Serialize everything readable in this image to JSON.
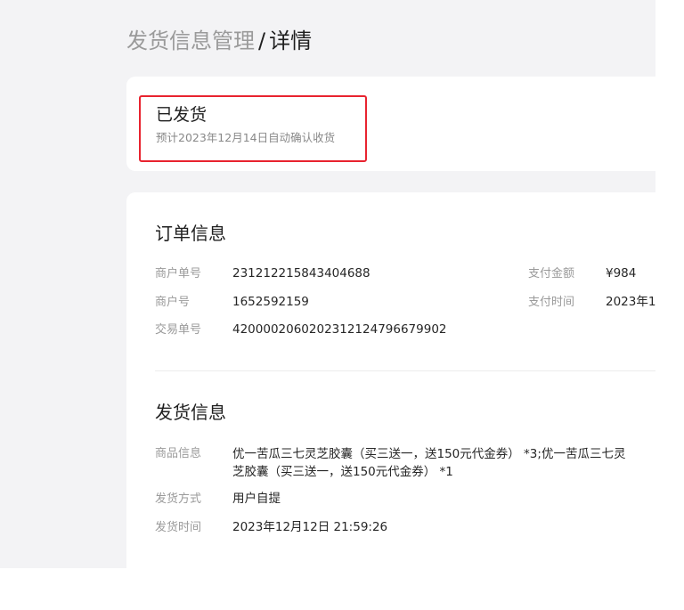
{
  "breadcrumb": {
    "parent": "发货信息管理",
    "separator": "/",
    "current": "详情"
  },
  "status": {
    "title": "已发货",
    "subtitle": "预计2023年12月14日自动确认收货",
    "highlight_color": "#e8232f"
  },
  "order_info": {
    "title": "订单信息",
    "merchant_order_no": {
      "label": "商户单号",
      "value": "231212215843404688"
    },
    "merchant_no": {
      "label": "商户号",
      "value": "1652592159"
    },
    "transaction_no": {
      "label": "交易单号",
      "value": "4200002060202312124796679902"
    },
    "pay_amount": {
      "label": "支付金额",
      "value": "¥984"
    },
    "pay_time": {
      "label": "支付时间",
      "value": "2023年1"
    }
  },
  "shipping_info": {
    "title": "发货信息",
    "product": {
      "label": "商品信息",
      "value": "优一苦瓜三七灵芝胶囊（买三送一，送150元代金券） *3;优一苦瓜三七灵芝胶囊（买三送一，送150元代金券） *1"
    },
    "method": {
      "label": "发货方式",
      "value": "用户自提"
    },
    "time": {
      "label": "发货时间",
      "value": "2023年12月12日 21:59:26"
    }
  }
}
